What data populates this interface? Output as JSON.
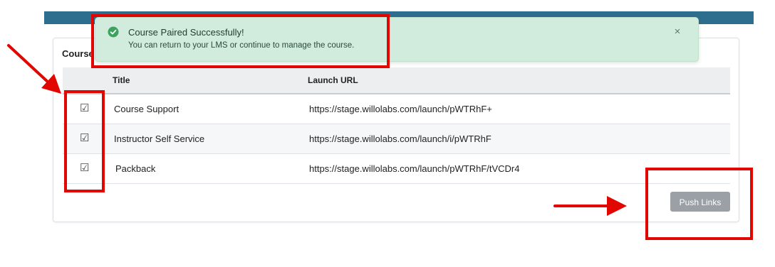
{
  "card": {
    "title": "Course",
    "columns": {
      "title": "Title",
      "launch_url": "Launch URL"
    },
    "rows": [
      {
        "checkbox": "☑",
        "title": "Course Support",
        "url": "https://stage.willolabs.com/launch/pWTRhF+"
      },
      {
        "checkbox": "☑",
        "title": "Instructor Self Service",
        "url": "https://stage.willolabs.com/launch/i/pWTRhF"
      },
      {
        "checkbox": "☑",
        "title": "Packback",
        "url": "https://stage.willolabs.com/launch/pWTRhF/tVCDr4"
      }
    ],
    "push_button": "Push Links"
  },
  "toast": {
    "title": "Course Paired Successfully!",
    "message": "You can return to your LMS or continue to manage the course.",
    "close": "×"
  },
  "colors": {
    "topbar": "#2d6e8e",
    "toast_bg": "#d1ebdc",
    "success_icon": "#3aa45f",
    "annotation": "#e10600",
    "button_disabled": "#9aa0a5"
  },
  "icons": {
    "toast": "check-circle-icon",
    "close": "close-icon",
    "checkbox": "checked-checkbox-icon"
  }
}
